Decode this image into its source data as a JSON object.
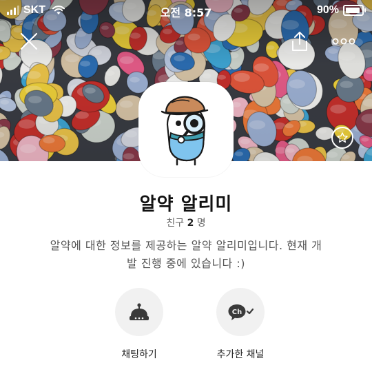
{
  "status_bar": {
    "carrier": "SKT",
    "time": "오전 8:57",
    "battery": "90%",
    "battery_level": 0.9
  },
  "header": {
    "icons": [
      "close-icon",
      "share-icon",
      "more-icon",
      "star-icon"
    ]
  },
  "profile": {
    "name": "알약 알리미",
    "friends_label": "친구",
    "friends_count": "2",
    "friends_unit": "명",
    "description_line1": "알약에 대한 정보를 제공하는 알약 알리미입니다. 현재 개",
    "description_line2": "발 진행 중에 있습니다 :)",
    "avatar": "pill-detective-mascot"
  },
  "actions": [
    {
      "label": "채팅하기",
      "icon": "chat-bot-icon"
    },
    {
      "label": "추가한 채널",
      "icon": "channel-added-icon",
      "badge": "Ch"
    }
  ],
  "colors": {
    "background": "#ffffff",
    "action_circle": "#f1f1f1",
    "text_primary": "#111111",
    "text_secondary": "#666666"
  }
}
